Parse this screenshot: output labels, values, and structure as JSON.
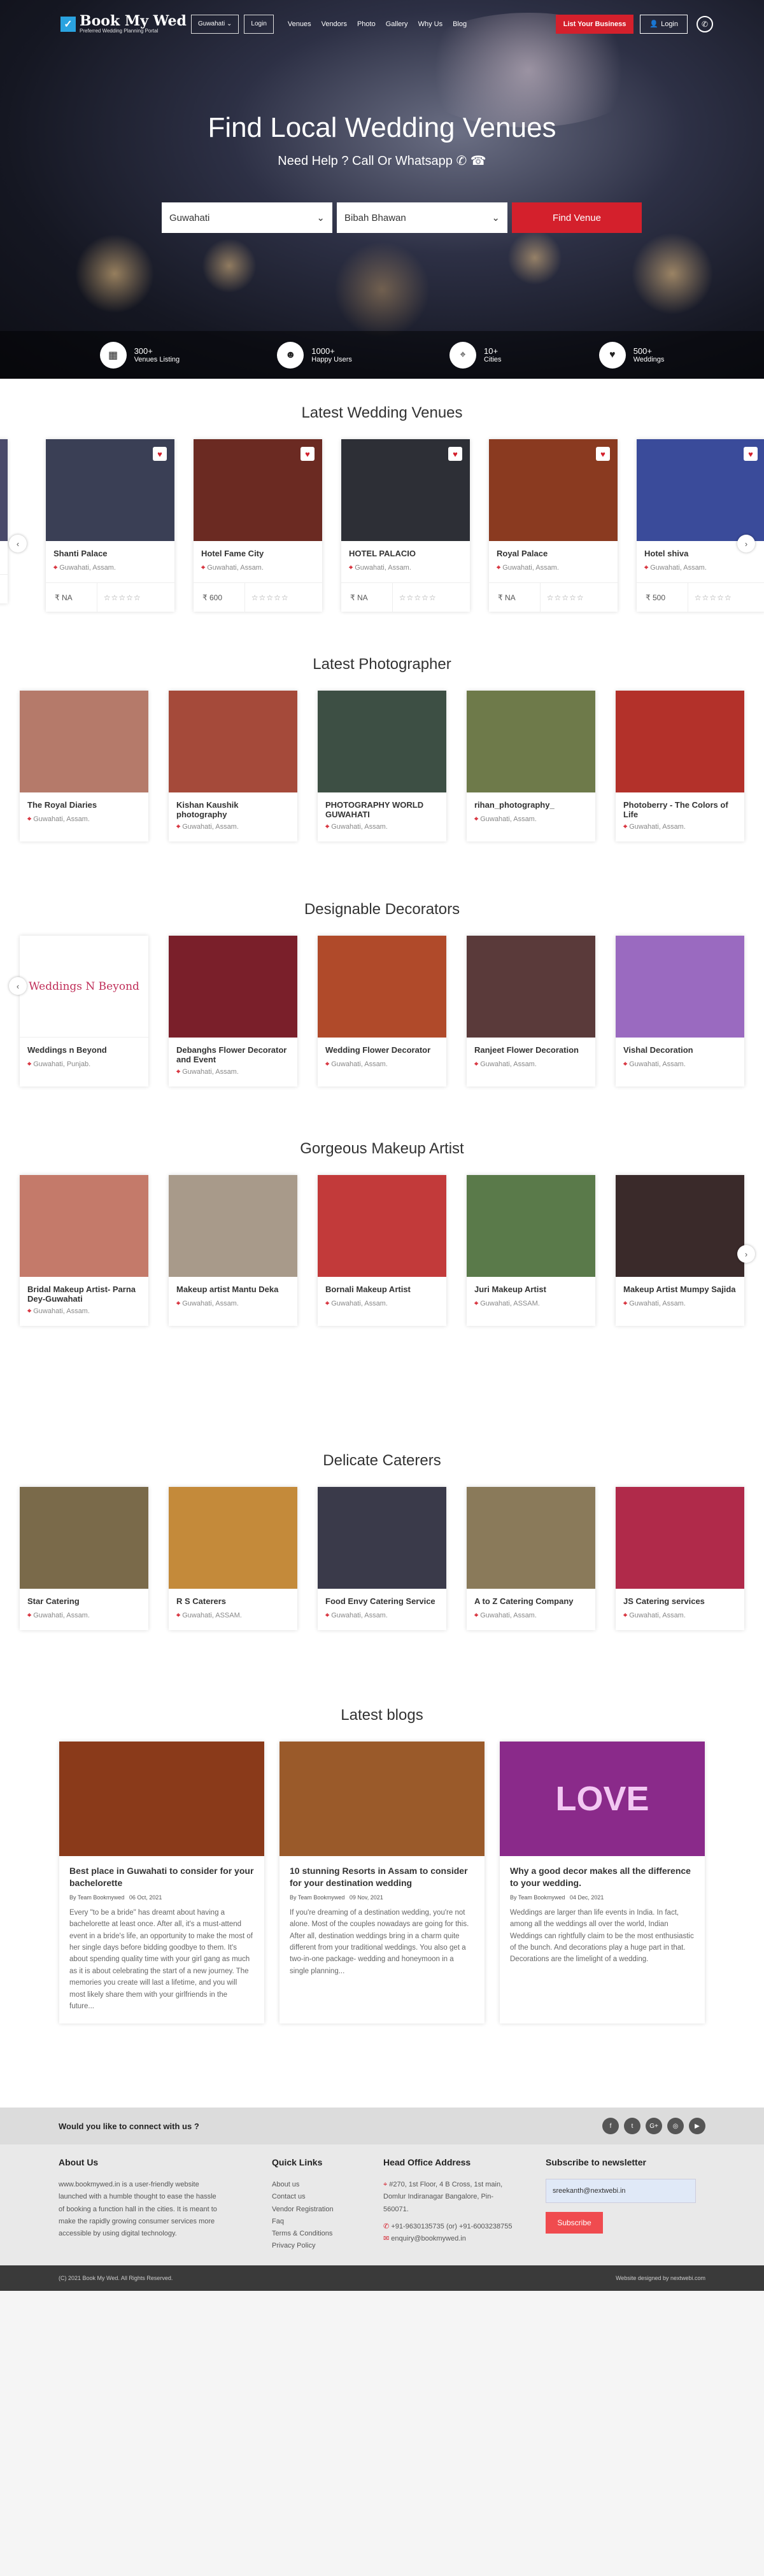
{
  "header": {
    "logo_title": "Book My Wed",
    "logo_sub": "Preferred Wedding Planning Portal",
    "city": "Guwahati",
    "city_caret": "⌄",
    "login_shortcut": "Login",
    "menu": [
      "Venues",
      "Vendors",
      "Photo",
      "Gallery",
      "Why Us",
      "Blog"
    ],
    "list_business": "List Your Business",
    "login": "Login"
  },
  "hero": {
    "title": "Find Local Wedding Venues",
    "subtitle": "Need Help ? Call Or Whatsapp",
    "location": "Guwahati",
    "venue_type": "Bibah Bhawan",
    "find_button": "Find Venue"
  },
  "stats": [
    {
      "num": "300+",
      "label": "Venues Listing",
      "icon": "building-icon"
    },
    {
      "num": "1000+",
      "label": "Happy Users",
      "icon": "user-icon"
    },
    {
      "num": "10+",
      "label": "Cities",
      "icon": "map-pin-icon"
    },
    {
      "num": "500+",
      "label": "Weddings",
      "icon": "heart-icon"
    }
  ],
  "venues": {
    "heading": "Latest Wedding Venues",
    "items": [
      {
        "name": "Shanti Palace",
        "loc": "Guwahati, Assam.",
        "price": "₹ NA",
        "color": "#3a3f55"
      },
      {
        "name": "Hotel Fame City",
        "loc": "Guwahati, Assam.",
        "price": "₹ 600",
        "color": "#6b2a22"
      },
      {
        "name": "HOTEL PALACIO",
        "loc": "Guwahati, Assam.",
        "price": "₹ NA",
        "color": "#2d2f36"
      },
      {
        "name": "Royal Palace",
        "loc": "Guwahati, Assam.",
        "price": "₹ NA",
        "color": "#8a3a20"
      },
      {
        "name": "Hotel shiva",
        "loc": "Guwahati, Assam.",
        "price": "₹ 500",
        "color": "#3a4b9a"
      }
    ],
    "stars": "☆☆☆☆☆"
  },
  "photographers": {
    "heading": "Latest Photographer",
    "items": [
      {
        "name": "The Royal Diaries",
        "loc": "Guwahati, Assam.",
        "color": "#b57a6a"
      },
      {
        "name": "Kishan Kaushik photography",
        "loc": "Guwahati, Assam.",
        "color": "#a54a3a"
      },
      {
        "name": "PHOTOGRAPHY WORLD GUWAHATI",
        "loc": "Guwahati, Assam.",
        "color": "#3d4f44"
      },
      {
        "name": "rihan_photography_",
        "loc": "Guwahati, Assam.",
        "color": "#6e7a4a"
      },
      {
        "name": "Photoberry - The Colors of Life",
        "loc": "Guwahati, Assam.",
        "color": "#b3312a"
      }
    ]
  },
  "decorators": {
    "heading": "Designable Decorators",
    "items": [
      {
        "name": "Weddings n Beyond",
        "loc": "Guwahati, Punjab.",
        "color": "#ffffff",
        "logo_text": "Weddings N Beyond"
      },
      {
        "name": "Debanghs Flower Decorator and Event",
        "loc": "Guwahati, Assam.",
        "color": "#7a1f2a"
      },
      {
        "name": "Wedding Flower Decorator",
        "loc": "Guwahati, Assam.",
        "color": "#b04a2a"
      },
      {
        "name": "Ranjeet Flower Decoration",
        "loc": "Guwahati, Assam.",
        "color": "#5a3a3a"
      },
      {
        "name": "Vishal Decoration",
        "loc": "Guwahati, Assam.",
        "color": "#9a6ac0"
      }
    ]
  },
  "makeup": {
    "heading": "Gorgeous Makeup Artist",
    "items": [
      {
        "name": "Bridal Makeup Artist- Parna Dey-Guwahati",
        "loc": "Guwahati, Assam.",
        "color": "#c47a6a"
      },
      {
        "name": "Makeup artist Mantu Deka",
        "loc": "Guwahati, Assam.",
        "color": "#a89a8a"
      },
      {
        "name": "Bornali Makeup Artist",
        "loc": "Guwahati, Assam.",
        "color": "#c23a3a"
      },
      {
        "name": "Juri Makeup Artist",
        "loc": "Guwahati, ASSAM.",
        "color": "#5a7a4a"
      },
      {
        "name": "Makeup Artist Mumpy Sajida",
        "loc": "Guwahati, Assam.",
        "color": "#3a2a2a"
      }
    ]
  },
  "caterers": {
    "heading": "Delicate Caterers",
    "items": [
      {
        "name": "Star Catering",
        "loc": "Guwahati, Assam.",
        "color": "#7a6a4a"
      },
      {
        "name": "R S Caterers",
        "loc": "Guwahati, ASSAM.",
        "color": "#c48a3a"
      },
      {
        "name": "Food Envy Catering Service",
        "loc": "Guwahati, Assam.",
        "color": "#3a3a4a"
      },
      {
        "name": "A to Z Catering Company",
        "loc": "Guwahati, Assam.",
        "color": "#8a7a5a"
      },
      {
        "name": "JS Catering services",
        "loc": "Guwahati, Assam.",
        "color": "#b02a4a"
      }
    ]
  },
  "blogs": {
    "heading": "Latest blogs",
    "items": [
      {
        "title": "Best place in Guwahati to consider for your bachelorette",
        "author": "By Team Bookmywed",
        "date": "06 Oct, 2021",
        "text": "Every \"to be a bride\" has dreamt about having a bachelorette at least once. After all, it's a must-attend event in a bride's life, an opportunity to make the most of her single days before bidding goodbye to them. It's about spending quality time with your girl gang as much as it is about celebrating the start of a new journey. The memories you create will last a lifetime, and you will most likely share them with your girlfriends in the future...",
        "color": "#8a3a1a"
      },
      {
        "title": "10 stunning Resorts in Assam to consider for your destination wedding",
        "author": "By Team Bookmywed",
        "date": "09 Nov, 2021",
        "text": "If you're dreaming of a destination wedding, you're not alone. Most of the couples nowadays are going for this. After all, destination weddings bring in a charm quite different from your traditional weddings. You also get a two-in-one package- wedding and honeymoon in a single planning...",
        "color": "#9a5a2a"
      },
      {
        "title": "Why a good decor makes all the difference to your wedding.",
        "author": "By Team Bookmywed",
        "date": "04 Dec, 2021",
        "text": "Weddings are larger than life events in India. In fact, among all the weddings all over the world, Indian Weddings can rightfully claim to be the most enthusiastic of the bunch. And decorations play a huge part in that. Decorations are the limelight of a wedding.",
        "color": "#8a2a8a",
        "img_text": "LOVE"
      }
    ]
  },
  "footer": {
    "connect": "Would you like to connect with us ?",
    "social": [
      "f",
      "t",
      "G+",
      "◎",
      "▶"
    ],
    "about_title": "About Us",
    "about_text": "www.bookmywed.in is a user-friendly website launched with a humble thought to ease the hassle of booking a function hall in the cities. It is meant to make the rapidly growing consumer services more accessible by using digital technology.",
    "links_title": "Quick Links",
    "links": [
      "About us",
      "Contact us",
      "Vendor Registration",
      "Faq",
      "Terms & Conditions",
      "Privacy Policy"
    ],
    "office_title": "Head Office Address",
    "address": "#270, 1st Floor, 4 B Cross, 1st main, Domlur Indiranagar Bangalore, Pin- 560071.",
    "phone": "+91-9630135735 (or) +91-6003238755",
    "email": "enquiry@bookmywed.in",
    "news_title": "Subscribe to newsletter",
    "news_value": "sreekanth@nextwebi.in",
    "subscribe": "Subscribe",
    "copyright": "(C) 2021 Book My Wed. All Rights Reserved.",
    "credit": "Website designed by nextwebi.com"
  }
}
